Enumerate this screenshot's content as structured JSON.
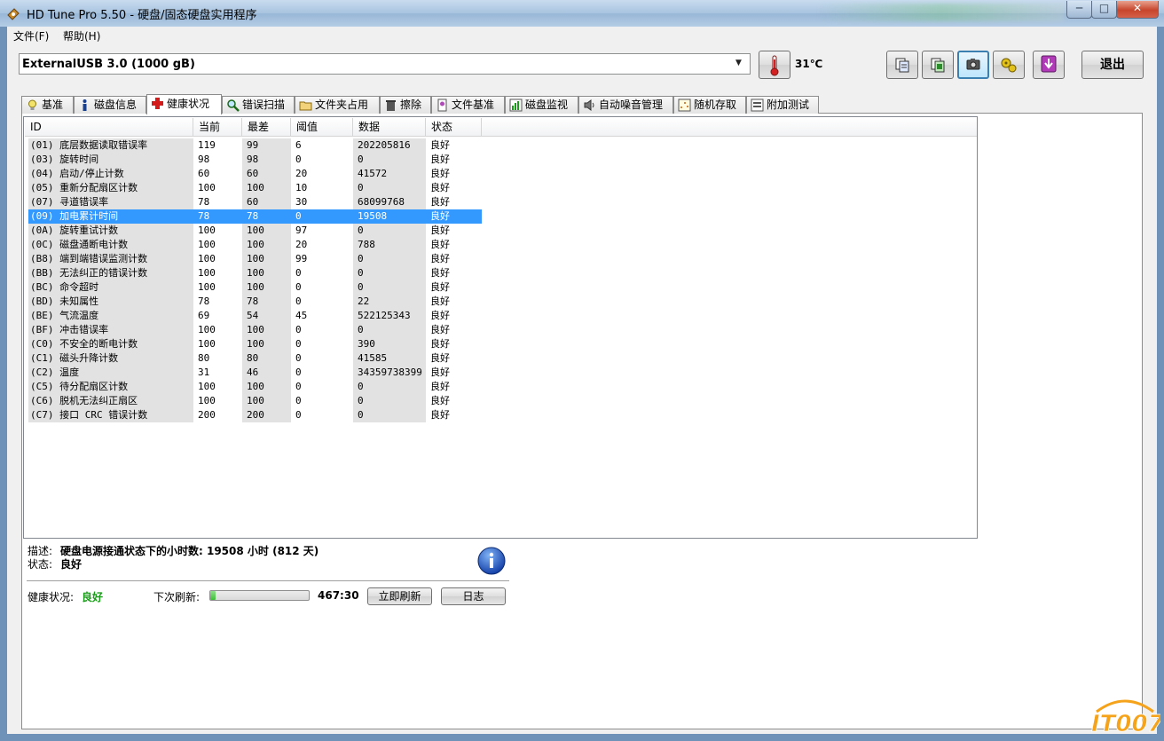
{
  "window": {
    "title": "HD Tune Pro 5.50 - 硬盘/固态硬盘实用程序",
    "min_label": "─",
    "max_label": "□",
    "close_label": "✕"
  },
  "menu": {
    "items": [
      "文件(F)",
      "帮助(H)"
    ]
  },
  "toolbar": {
    "drive": "ExternalUSB 3.0 (1000 gB)",
    "dropdown_icon": "▼",
    "temperature": "31℃",
    "exit_label": "退出",
    "icons": [
      "thermometer-icon",
      "copy-info-icon",
      "copy-screen-icon",
      "camera-icon",
      "options-icon",
      "save-icon"
    ]
  },
  "tabs": [
    {
      "label": "基准",
      "icon": "bulb-icon"
    },
    {
      "label": "磁盘信息",
      "icon": "info-icon"
    },
    {
      "label": "健康状况",
      "icon": "health-cross-icon",
      "active": true
    },
    {
      "label": "错误扫描",
      "icon": "magnifier-icon"
    },
    {
      "label": "文件夹占用",
      "icon": "folder-icon"
    },
    {
      "label": "擦除",
      "icon": "trash-icon"
    },
    {
      "label": "文件基准",
      "icon": "file-benchmark-icon"
    },
    {
      "label": "磁盘监视",
      "icon": "monitor-chart-icon"
    },
    {
      "label": "自动噪音管理",
      "icon": "speaker-icon"
    },
    {
      "label": "随机存取",
      "icon": "random-access-icon"
    },
    {
      "label": "附加测试",
      "icon": "extra-tests-icon"
    }
  ],
  "smart": {
    "columns": [
      "ID",
      "当前",
      "最差",
      "阈值",
      "数据",
      "状态"
    ],
    "selected_index": 5,
    "rows": [
      [
        "(01) 底层数据读取错误率",
        "119",
        "99",
        "6",
        "202205816",
        "良好"
      ],
      [
        "(03) 旋转时间",
        "98",
        "98",
        "0",
        "0",
        "良好"
      ],
      [
        "(04) 启动/停止计数",
        "60",
        "60",
        "20",
        "41572",
        "良好"
      ],
      [
        "(05) 重新分配扇区计数",
        "100",
        "100",
        "10",
        "0",
        "良好"
      ],
      [
        "(07) 寻道错误率",
        "78",
        "60",
        "30",
        "68099768",
        "良好"
      ],
      [
        "(09) 加电累计时间",
        "78",
        "78",
        "0",
        "19508",
        "良好"
      ],
      [
        "(0A) 旋转重试计数",
        "100",
        "100",
        "97",
        "0",
        "良好"
      ],
      [
        "(0C) 磁盘通断电计数",
        "100",
        "100",
        "20",
        "788",
        "良好"
      ],
      [
        "(B8) 端到端错误监测计数",
        "100",
        "100",
        "99",
        "0",
        "良好"
      ],
      [
        "(BB) 无法纠正的错误计数",
        "100",
        "100",
        "0",
        "0",
        "良好"
      ],
      [
        "(BC) 命令超时",
        "100",
        "100",
        "0",
        "0",
        "良好"
      ],
      [
        "(BD) 未知属性",
        "78",
        "78",
        "0",
        "22",
        "良好"
      ],
      [
        "(BE) 气流温度",
        "69",
        "54",
        "45",
        "522125343",
        "良好"
      ],
      [
        "(BF) 冲击错误率",
        "100",
        "100",
        "0",
        "0",
        "良好"
      ],
      [
        "(C0) 不安全的断电计数",
        "100",
        "100",
        "0",
        "390",
        "良好"
      ],
      [
        "(C1) 磁头升降计数",
        "80",
        "80",
        "0",
        "41585",
        "良好"
      ],
      [
        "(C2) 温度",
        "31",
        "46",
        "0",
        "34359738399",
        "良好"
      ],
      [
        "(C5) 待分配扇区计数",
        "100",
        "100",
        "0",
        "0",
        "良好"
      ],
      [
        "(C6) 脱机无法纠正扇区",
        "100",
        "100",
        "0",
        "0",
        "良好"
      ],
      [
        "(C7) 接口 CRC 错误计数",
        "200",
        "200",
        "0",
        "0",
        "良好"
      ]
    ]
  },
  "details": {
    "desc_label": "描述:",
    "desc_value": "硬盘电源接通状态下的小时数: 19508 小时 (812 天)",
    "status_label": "状态:",
    "status_value": "良好"
  },
  "footer": {
    "health_label": "健康状况:",
    "health_value": "良好",
    "next_refresh_label": "下次刷新:",
    "progress_fraction": 0.05,
    "countdown": "467:30",
    "refresh_button": "立即刷新",
    "log_button": "日志"
  },
  "watermark": "IT007",
  "colors": {
    "selection": "#3399ff",
    "health_good": "#1a9c1a"
  }
}
